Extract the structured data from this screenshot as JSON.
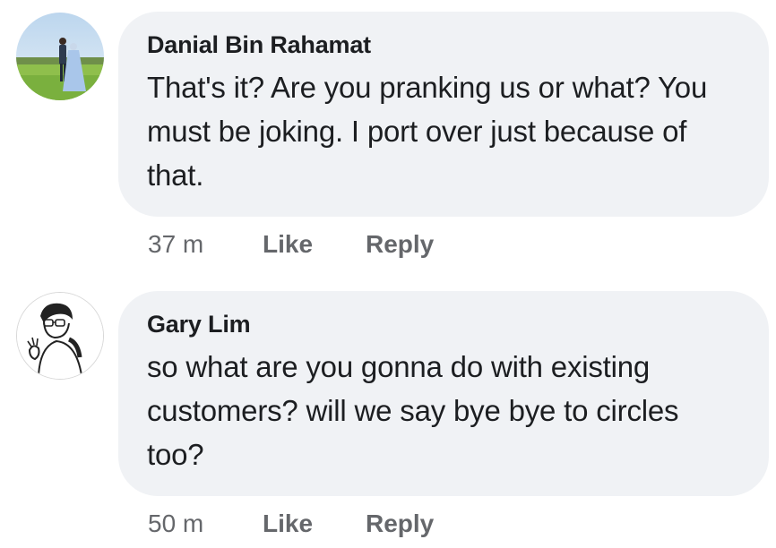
{
  "comments": [
    {
      "author": "Danial Bin Rahamat",
      "text": "That's it? Are you pranking us or what? You must be joking. I port over just because of that.",
      "time": "37 m",
      "like_label": "Like",
      "reply_label": "Reply",
      "avatar_icon": "wedding-couple-photo-avatar"
    },
    {
      "author": "Gary Lim",
      "text": "so what are you gonna do with existing customers? will we say bye bye to circles too?",
      "time": "50 m",
      "like_label": "Like",
      "reply_label": "Reply",
      "avatar_icon": "sketch-person-avatar"
    }
  ],
  "colors": {
    "bubble_bg": "#f0f2f5",
    "text": "#1c1e21",
    "meta": "#65676b"
  }
}
